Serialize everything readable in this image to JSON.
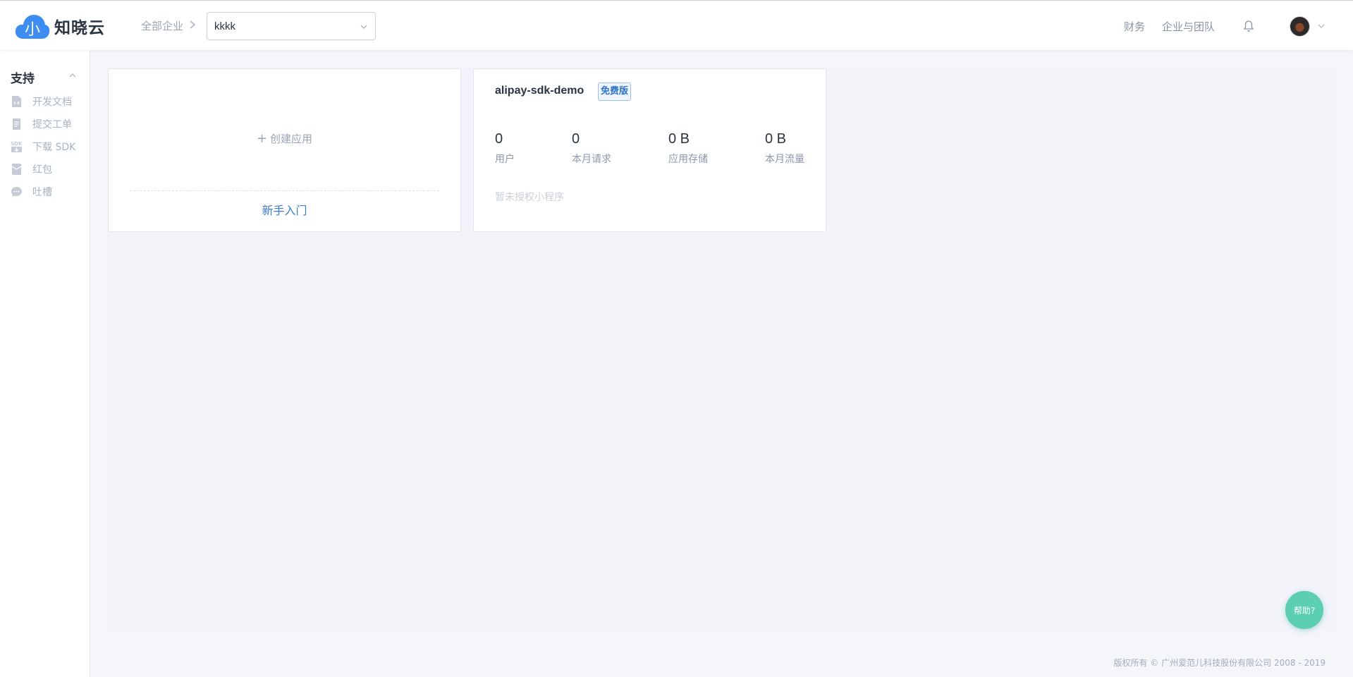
{
  "header": {
    "logo_text": "知晓云",
    "logo_mark_glyph": "小",
    "brand_color": "#3d8ef0",
    "breadcrumb_root": "全部企业",
    "org_select_value": "kkkk",
    "nav_finance": "财务",
    "nav_team": "企业与团队"
  },
  "sidebar": {
    "title": "支持",
    "items": [
      {
        "label": "开发文档",
        "icon": "document-icon"
      },
      {
        "label": "提交工单",
        "icon": "ticket-icon"
      },
      {
        "label": "下载 SDK",
        "icon": "sdk-download-icon"
      },
      {
        "label": "红包",
        "icon": "red-packet-icon"
      },
      {
        "label": "吐槽",
        "icon": "chat-bubble-icon"
      }
    ]
  },
  "create_card": {
    "create_label": "创建应用",
    "beginner_label": "新手入门"
  },
  "app_card": {
    "name": "alipay-sdk-demo",
    "badge": "免费版",
    "stats": [
      {
        "value": "0",
        "label": "用户"
      },
      {
        "value": "0",
        "label": "本月请求"
      },
      {
        "value": "0 B",
        "label": "应用存储"
      },
      {
        "value": "0 B",
        "label": "本月流量"
      }
    ],
    "miniapp_status": "暂未授权小程序"
  },
  "help_button": "帮助?",
  "footer": "版权所有 © 广州爱范儿科技股份有限公司 2008 - 2019"
}
